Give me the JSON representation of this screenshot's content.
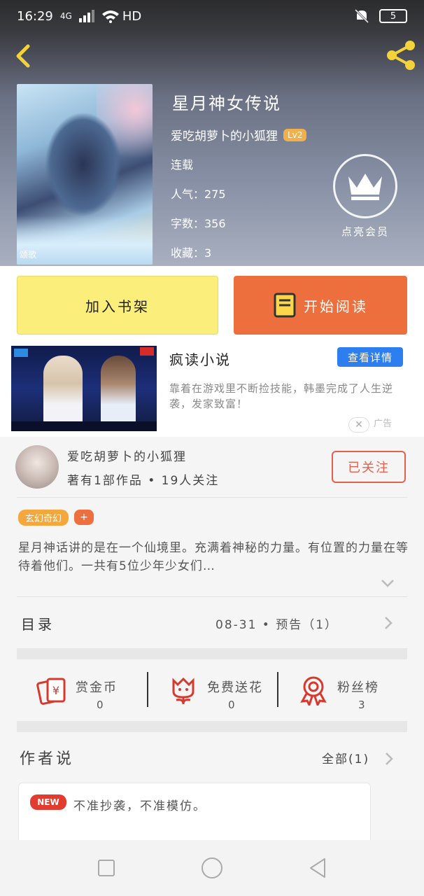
{
  "status_bar": {
    "time": "16:29",
    "network": "4G",
    "hd": "HD",
    "battery": "5"
  },
  "book": {
    "title": "星月神女传说",
    "author": "爱吃胡萝卜的小狐狸",
    "level": "Lv2",
    "status": "连载",
    "popularity": "人气：275",
    "word_count": "字数：356",
    "favorites": "收藏：3",
    "cover_mark": "颂歌"
  },
  "vip": {
    "label": "点亮会员"
  },
  "actions": {
    "add_shelf": "加入书架",
    "start_read": "开始阅读"
  },
  "ad": {
    "title": "疯读小说",
    "button": "查看详情",
    "description": "靠着在游戏里不断捡技能，韩墨完成了人生逆袭，发家致富！",
    "close": "✕",
    "mark": "广告"
  },
  "author_card": {
    "name": "爱吃胡萝卜的小狐狸",
    "stats": "著有1部作品 • 19人关注",
    "follow": "已关注"
  },
  "tags": {
    "genre": "玄幻奇幻",
    "add": "+"
  },
  "synopsis": "星月神话讲的是在一个仙境里。充满着神秘的力量。有位置的力量在等待着他们。一共有5位少年少女们…",
  "catalog": {
    "label": "目录",
    "info": "08-31 • 预告（1）"
  },
  "stats": [
    {
      "label": "赏金币",
      "value": "0",
      "icon": "reward-coin-icon"
    },
    {
      "label": "免费送花",
      "value": "0",
      "icon": "flower-icon"
    },
    {
      "label": "粉丝榜",
      "value": "3",
      "icon": "medal-icon"
    }
  ],
  "author_says": {
    "title": "作者说",
    "all": "全部(1)",
    "badge": "NEW",
    "text": "不准抄袭，不准模仿。"
  },
  "colors": {
    "accent": "#ec6f3d",
    "yellow": "#fbee7a",
    "blue": "#2d7ff0"
  }
}
